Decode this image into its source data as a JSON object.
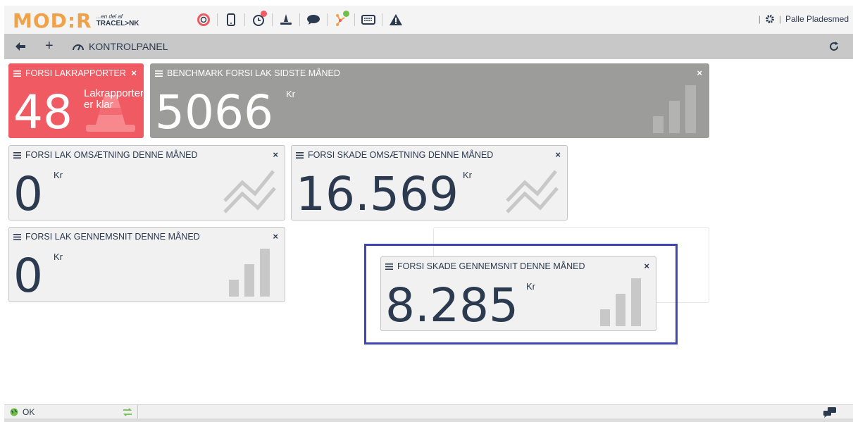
{
  "app": {
    "logo_main": "MOD:R",
    "logo_tagline": "...en del af",
    "logo_brand": "TRACEL>NK"
  },
  "toolbar": {
    "icons": [
      "lifebuoy-icon",
      "mobile-icon",
      "clock-icon",
      "cone-icon",
      "chat-icon",
      "network-icon",
      "keyboard-icon",
      "warning-icon"
    ],
    "user_name": "Palle Pladesmed",
    "colors": {
      "notification_red": "#f05a63",
      "notification_green": "#6fbf4a",
      "logo_orange": "#f0a24a"
    }
  },
  "nav": {
    "title": "KONTROLPANEL"
  },
  "widgets": {
    "lak_rapporter": {
      "title": "FORSI LAKRAPPORTER",
      "value": "48",
      "text_line1": "Lakrapporter",
      "text_line2": "er klar",
      "close": "×",
      "color": "#f05a63"
    },
    "benchmark": {
      "title": "BENCHMARK FORSI LAK SIDSTE MÅNED",
      "value": "5066",
      "unit": "Kr",
      "close": "×",
      "color": "#9c9c9a"
    },
    "lak_omsaetning": {
      "title": "FORSI LAK OMSÆTNING DENNE MÅNED",
      "value": "0",
      "unit": "Kr",
      "close": "×"
    },
    "skade_omsaetning": {
      "title": "FORSI SKADE OMSÆTNING DENNE MÅNED",
      "value": "16.569",
      "unit": "Kr",
      "close": "×"
    },
    "lak_gennemsnit": {
      "title": "FORSI LAK GENNEMSNIT DENNE MÅNED",
      "value": "0",
      "unit": "Kr",
      "close": "×"
    },
    "skade_gennemsnit": {
      "title": "FORSI SKADE GENNEMSNIT DENNE MÅNED",
      "value": "8.285",
      "unit": "Kr",
      "close": "×"
    }
  },
  "status": {
    "text": "OK",
    "highlight_color": "#3f45b6"
  }
}
